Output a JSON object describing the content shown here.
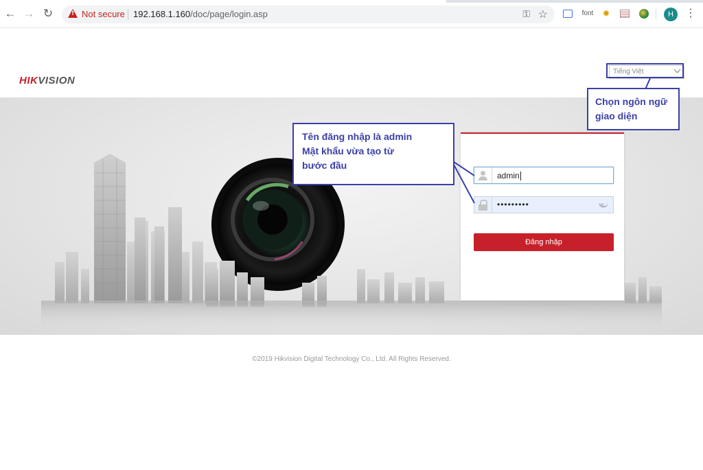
{
  "browser": {
    "security_label": "Not secure",
    "url_host": "192.168.1.160",
    "url_path": "/doc/page/login.asp",
    "extensions": [
      "font"
    ],
    "profile_initial": "H",
    "profile_color": "#1a8c8c"
  },
  "header": {
    "logo_part1": "HIK",
    "logo_part2": "VISION",
    "language_selected": "Tiếng Việt"
  },
  "login": {
    "username_value": "admin",
    "password_value": "•••••••••",
    "submit_label": "Đăng nhập",
    "accent_color": "#c8202a"
  },
  "annotations": {
    "login_note": [
      "Tên đăng nhập là admin",
      "Mật khẩu vừa tạo từ",
      "bước đầu"
    ],
    "language_note": [
      "Chọn ngôn ngữ",
      "giao diện"
    ],
    "color": "#3b3fa8"
  },
  "footer": {
    "copyright": "©2019 Hikvision Digital Technology Co., Ltd. All Rights Reserved."
  }
}
